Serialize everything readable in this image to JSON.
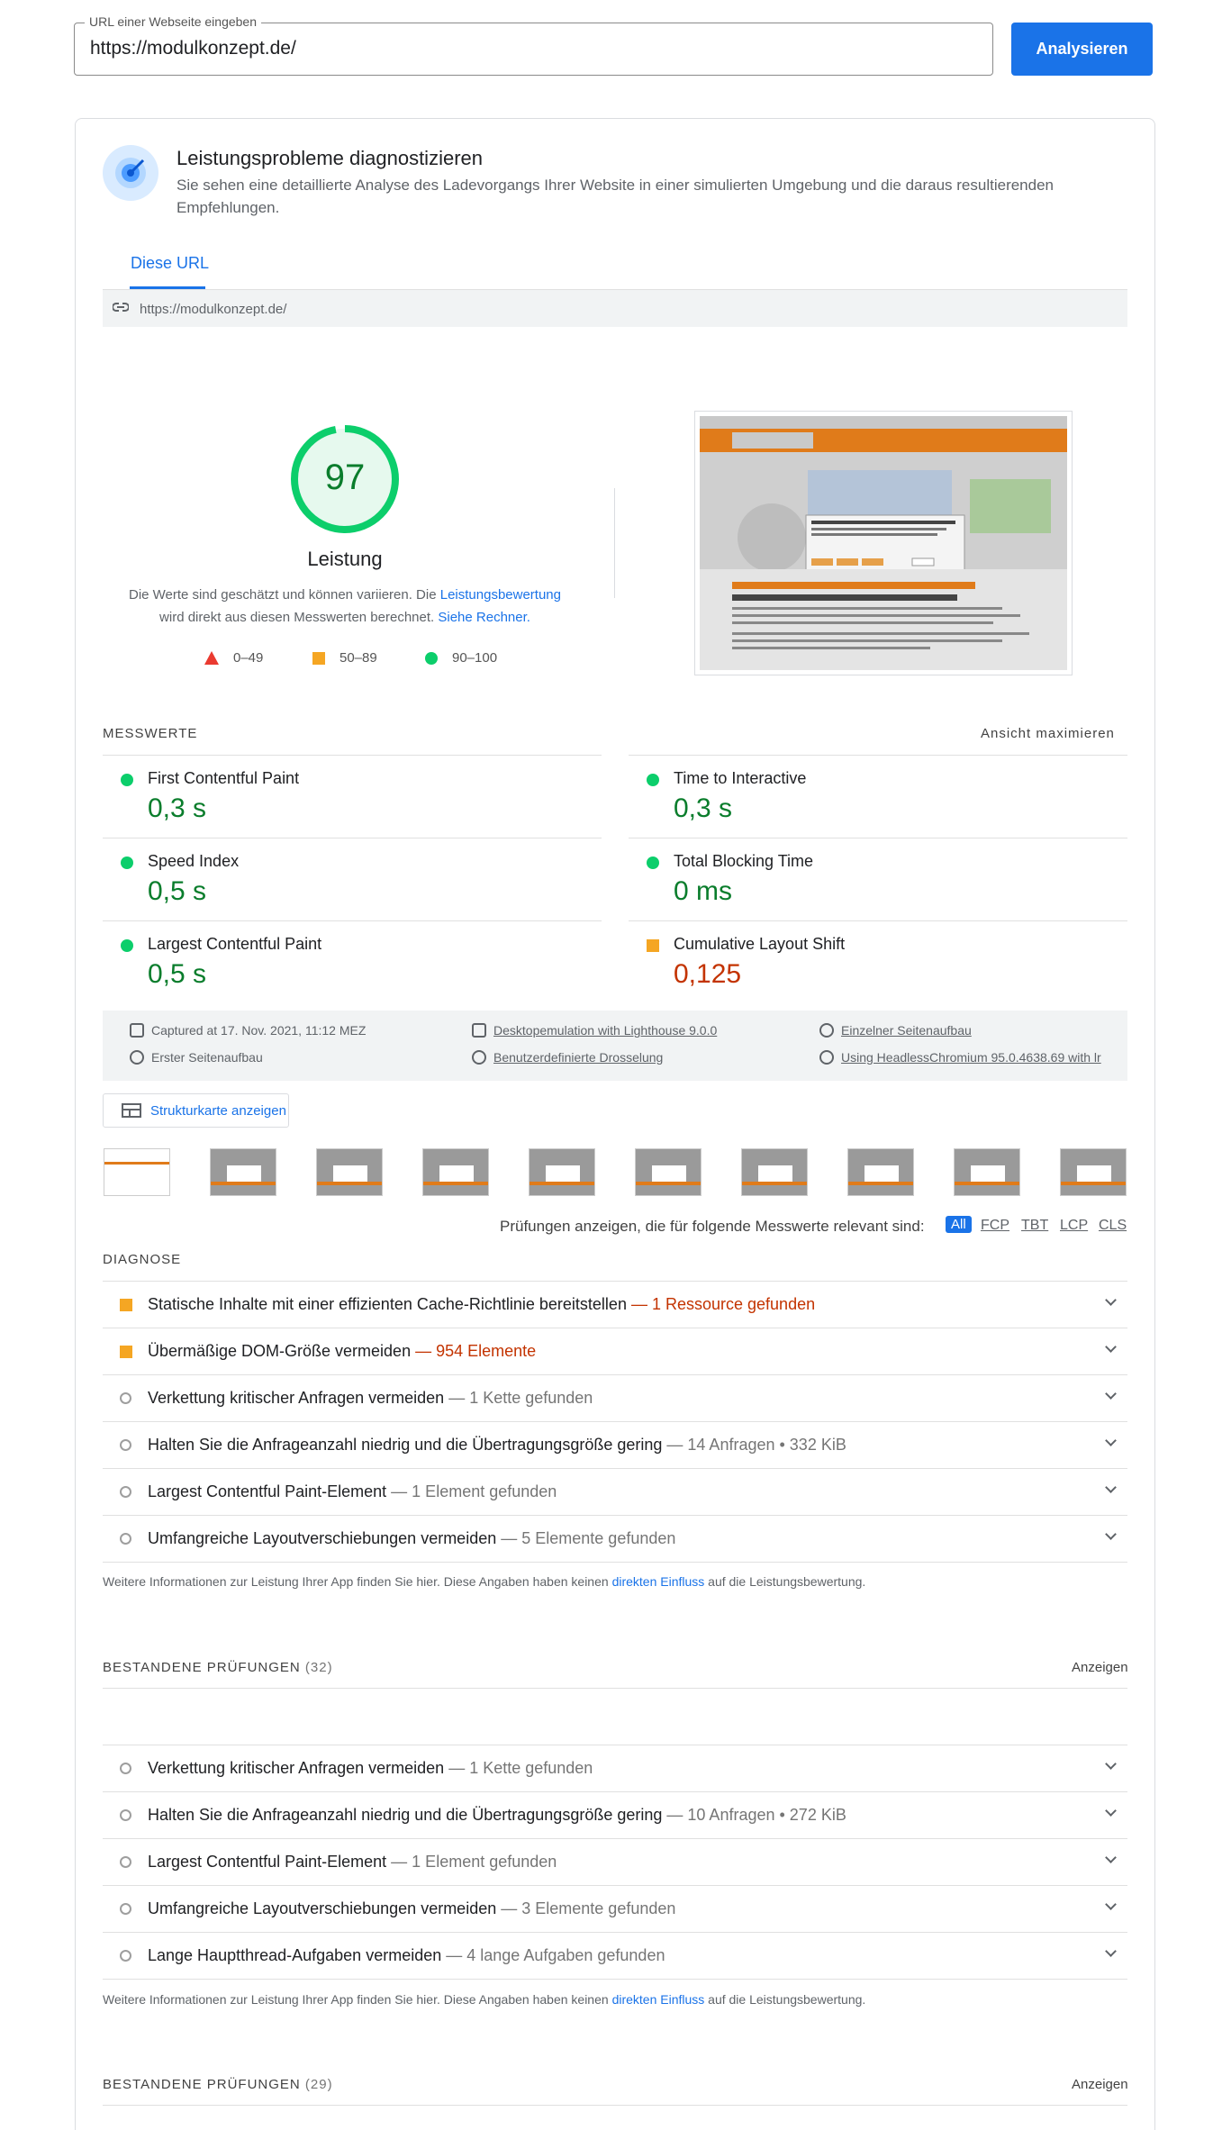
{
  "url_input": {
    "legend": "URL einer Webseite eingeben",
    "value": "https://modulkonzept.de/"
  },
  "analyze_label": "Analysieren",
  "diagnose_section": {
    "title": "Leistungsprobleme diagnostizieren",
    "description": "Sie sehen eine detaillierte Analyse des Ladevorgangs Ihrer Website in einer simulierten Umgebung und die daraus resultierenden Empfehlungen."
  },
  "tab_label": "Diese URL",
  "tested_url": "https://modulkonzept.de/",
  "score": {
    "value": "97",
    "fraction": 0.97,
    "label": "Leistung",
    "desc_part1": "Die Werte sind geschätzt und können variieren. Die ",
    "desc_link1": "Leistungsbewertung",
    "desc_part2": " wird direkt aus diesen Messwerten berechnet. ",
    "desc_link2": "Siehe Rechner."
  },
  "legend": {
    "fail": "0–49",
    "average": "50–89",
    "pass": "90–100"
  },
  "metrics": {
    "title": "MESSWERTE",
    "maximize": "Ansicht maximieren",
    "items": [
      {
        "name": "First Contentful Paint",
        "value": "0,3 s",
        "status": "pass"
      },
      {
        "name": "Time to Interactive",
        "value": "0,3 s",
        "status": "pass"
      },
      {
        "name": "Speed Index",
        "value": "0,5 s",
        "status": "pass"
      },
      {
        "name": "Total Blocking Time",
        "value": "0 ms",
        "status": "pass"
      },
      {
        "name": "Largest Contentful Paint",
        "value": "0,5 s",
        "status": "pass"
      },
      {
        "name": "Cumulative Layout Shift",
        "value": "0,125",
        "status": "average"
      }
    ]
  },
  "runtime_info": {
    "captured": "Captured at 17. Nov. 2021, 11:12 MEZ",
    "emulation": "Desktopemulation with Lighthouse 9.0.0",
    "page_load": "Einzelner Seitenaufbau",
    "initial_load": "Erster Seitenaufbau",
    "throttling": "Benutzerdefinierte Drosselung",
    "browser": "Using HeadlessChromium 95.0.4638.69 with lr"
  },
  "treemap_label": "Strukturkarte anzeigen",
  "filter": {
    "text": "Prüfungen anzeigen, die für folgende Messwerte relevant sind:",
    "options": [
      "All",
      "FCP",
      "TBT",
      "LCP",
      "CLS"
    ]
  },
  "diagnostics": {
    "title": "DIAGNOSE",
    "items": [
      {
        "title": "Statische Inhalte mit einer effizienten Cache-Richtlinie bereitstellen",
        "detail": "— 1 Ressource gefunden",
        "status": "average"
      },
      {
        "title": "Übermäßige DOM-Größe vermeiden",
        "detail": "— 954 Elemente",
        "status": "average"
      },
      {
        "title": "Verkettung kritischer Anfragen vermeiden",
        "detail": "— 1 Kette gefunden",
        "status": "info"
      },
      {
        "title": "Halten Sie die Anfrageanzahl niedrig und die Übertragungsgröße gering",
        "detail": "— 14 Anfragen • 332 KiB",
        "status": "info"
      },
      {
        "title": "Largest Contentful Paint-Element",
        "detail": "— 1 Element gefunden",
        "status": "info"
      },
      {
        "title": "Umfangreiche Layoutverschiebungen vermeiden",
        "detail": "— 5 Elemente gefunden",
        "status": "info"
      }
    ]
  },
  "note": {
    "part1": "Weitere Informationen zur Leistung Ihrer App finden Sie hier. Diese Angaben haben keinen ",
    "link": "direkten Einfluss",
    "part2": " auf die Leistungsbewertung."
  },
  "passed_1": {
    "title": "BESTANDENE PRÜFUNGEN",
    "count": "(32)",
    "show": "Anzeigen"
  },
  "diagnostics_2": {
    "items": [
      {
        "title": "Verkettung kritischer Anfragen vermeiden",
        "detail": "— 1 Kette gefunden"
      },
      {
        "title": "Halten Sie die Anfrageanzahl niedrig und die Übertragungsgröße gering",
        "detail": "— 10 Anfragen • 272 KiB"
      },
      {
        "title": "Largest Contentful Paint-Element",
        "detail": "— 1 Element gefunden"
      },
      {
        "title": "Umfangreiche Layoutverschiebungen vermeiden",
        "detail": "— 3 Elemente gefunden"
      },
      {
        "title": "Lange Hauptthread-Aufgaben vermeiden",
        "detail": "— 4 lange Aufgaben gefunden"
      }
    ]
  },
  "passed_2": {
    "title": "BESTANDENE PRÜFUNGEN",
    "count": "(29)",
    "show": "Anzeigen"
  },
  "colors": {
    "accent": "#1a73e8",
    "pass": "#0cce6b",
    "average": "#f5a623",
    "fail": "#ea3a30"
  }
}
